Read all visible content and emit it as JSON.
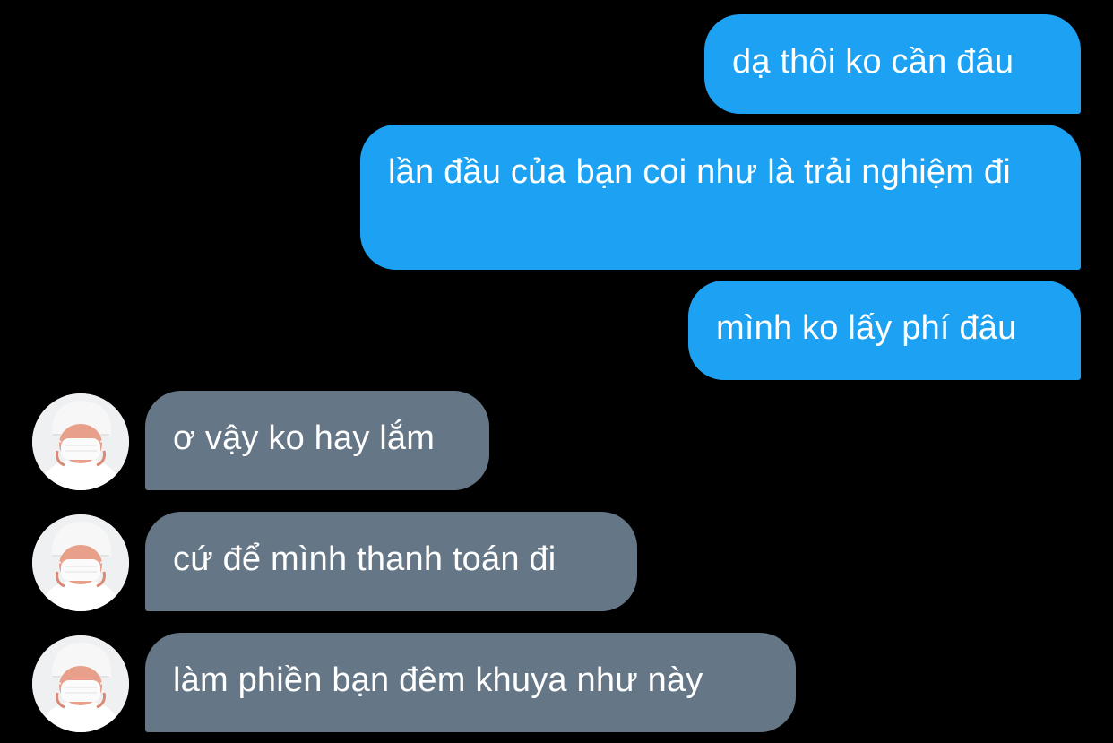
{
  "conversation": {
    "messages": [
      {
        "direction": "outgoing",
        "text": "dạ thôi ko cần đâu"
      },
      {
        "direction": "outgoing",
        "text": "lần đầu của bạn coi như là trải nghiệm đi"
      },
      {
        "direction": "outgoing",
        "text": "mình ko lấy phí đâu"
      },
      {
        "direction": "incoming",
        "text": "ơ vậy ko hay lắm"
      },
      {
        "direction": "incoming",
        "text": "cứ để mình thanh toán đi"
      },
      {
        "direction": "incoming",
        "text": "làm phiền bạn đêm khuya như này"
      }
    ]
  },
  "colors": {
    "background": "#000000",
    "outgoing_bubble": "#1da1f2",
    "incoming_bubble": "#657786",
    "bubble_text": "#ffffff"
  },
  "icons": {
    "avatar": "avatar-masked-person-icon"
  }
}
